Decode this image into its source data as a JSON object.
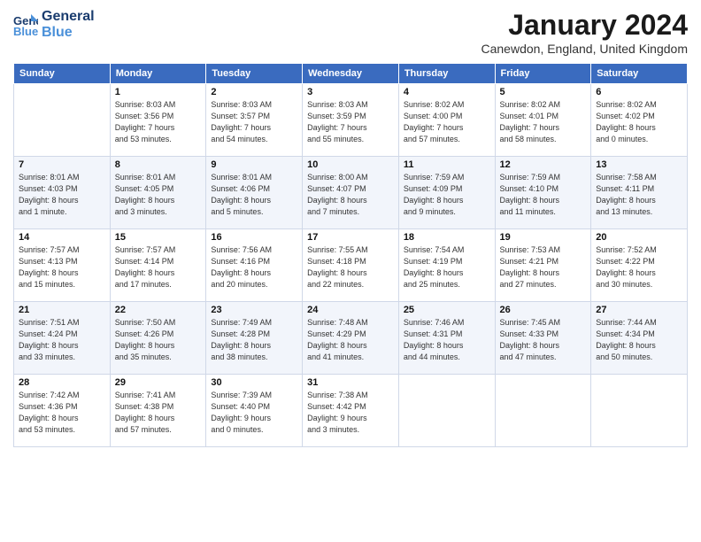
{
  "header": {
    "logo_line1": "General",
    "logo_line2": "Blue",
    "month_title": "January 2024",
    "location": "Canewdon, England, United Kingdom"
  },
  "weekdays": [
    "Sunday",
    "Monday",
    "Tuesday",
    "Wednesday",
    "Thursday",
    "Friday",
    "Saturday"
  ],
  "weeks": [
    [
      {
        "day": "",
        "info": ""
      },
      {
        "day": "1",
        "info": "Sunrise: 8:03 AM\nSunset: 3:56 PM\nDaylight: 7 hours\nand 53 minutes."
      },
      {
        "day": "2",
        "info": "Sunrise: 8:03 AM\nSunset: 3:57 PM\nDaylight: 7 hours\nand 54 minutes."
      },
      {
        "day": "3",
        "info": "Sunrise: 8:03 AM\nSunset: 3:59 PM\nDaylight: 7 hours\nand 55 minutes."
      },
      {
        "day": "4",
        "info": "Sunrise: 8:02 AM\nSunset: 4:00 PM\nDaylight: 7 hours\nand 57 minutes."
      },
      {
        "day": "5",
        "info": "Sunrise: 8:02 AM\nSunset: 4:01 PM\nDaylight: 7 hours\nand 58 minutes."
      },
      {
        "day": "6",
        "info": "Sunrise: 8:02 AM\nSunset: 4:02 PM\nDaylight: 8 hours\nand 0 minutes."
      }
    ],
    [
      {
        "day": "7",
        "info": "Sunrise: 8:01 AM\nSunset: 4:03 PM\nDaylight: 8 hours\nand 1 minute."
      },
      {
        "day": "8",
        "info": "Sunrise: 8:01 AM\nSunset: 4:05 PM\nDaylight: 8 hours\nand 3 minutes."
      },
      {
        "day": "9",
        "info": "Sunrise: 8:01 AM\nSunset: 4:06 PM\nDaylight: 8 hours\nand 5 minutes."
      },
      {
        "day": "10",
        "info": "Sunrise: 8:00 AM\nSunset: 4:07 PM\nDaylight: 8 hours\nand 7 minutes."
      },
      {
        "day": "11",
        "info": "Sunrise: 7:59 AM\nSunset: 4:09 PM\nDaylight: 8 hours\nand 9 minutes."
      },
      {
        "day": "12",
        "info": "Sunrise: 7:59 AM\nSunset: 4:10 PM\nDaylight: 8 hours\nand 11 minutes."
      },
      {
        "day": "13",
        "info": "Sunrise: 7:58 AM\nSunset: 4:11 PM\nDaylight: 8 hours\nand 13 minutes."
      }
    ],
    [
      {
        "day": "14",
        "info": "Sunrise: 7:57 AM\nSunset: 4:13 PM\nDaylight: 8 hours\nand 15 minutes."
      },
      {
        "day": "15",
        "info": "Sunrise: 7:57 AM\nSunset: 4:14 PM\nDaylight: 8 hours\nand 17 minutes."
      },
      {
        "day": "16",
        "info": "Sunrise: 7:56 AM\nSunset: 4:16 PM\nDaylight: 8 hours\nand 20 minutes."
      },
      {
        "day": "17",
        "info": "Sunrise: 7:55 AM\nSunset: 4:18 PM\nDaylight: 8 hours\nand 22 minutes."
      },
      {
        "day": "18",
        "info": "Sunrise: 7:54 AM\nSunset: 4:19 PM\nDaylight: 8 hours\nand 25 minutes."
      },
      {
        "day": "19",
        "info": "Sunrise: 7:53 AM\nSunset: 4:21 PM\nDaylight: 8 hours\nand 27 minutes."
      },
      {
        "day": "20",
        "info": "Sunrise: 7:52 AM\nSunset: 4:22 PM\nDaylight: 8 hours\nand 30 minutes."
      }
    ],
    [
      {
        "day": "21",
        "info": "Sunrise: 7:51 AM\nSunset: 4:24 PM\nDaylight: 8 hours\nand 33 minutes."
      },
      {
        "day": "22",
        "info": "Sunrise: 7:50 AM\nSunset: 4:26 PM\nDaylight: 8 hours\nand 35 minutes."
      },
      {
        "day": "23",
        "info": "Sunrise: 7:49 AM\nSunset: 4:28 PM\nDaylight: 8 hours\nand 38 minutes."
      },
      {
        "day": "24",
        "info": "Sunrise: 7:48 AM\nSunset: 4:29 PM\nDaylight: 8 hours\nand 41 minutes."
      },
      {
        "day": "25",
        "info": "Sunrise: 7:46 AM\nSunset: 4:31 PM\nDaylight: 8 hours\nand 44 minutes."
      },
      {
        "day": "26",
        "info": "Sunrise: 7:45 AM\nSunset: 4:33 PM\nDaylight: 8 hours\nand 47 minutes."
      },
      {
        "day": "27",
        "info": "Sunrise: 7:44 AM\nSunset: 4:34 PM\nDaylight: 8 hours\nand 50 minutes."
      }
    ],
    [
      {
        "day": "28",
        "info": "Sunrise: 7:42 AM\nSunset: 4:36 PM\nDaylight: 8 hours\nand 53 minutes."
      },
      {
        "day": "29",
        "info": "Sunrise: 7:41 AM\nSunset: 4:38 PM\nDaylight: 8 hours\nand 57 minutes."
      },
      {
        "day": "30",
        "info": "Sunrise: 7:39 AM\nSunset: 4:40 PM\nDaylight: 9 hours\nand 0 minutes."
      },
      {
        "day": "31",
        "info": "Sunrise: 7:38 AM\nSunset: 4:42 PM\nDaylight: 9 hours\nand 3 minutes."
      },
      {
        "day": "",
        "info": ""
      },
      {
        "day": "",
        "info": ""
      },
      {
        "day": "",
        "info": ""
      }
    ]
  ]
}
